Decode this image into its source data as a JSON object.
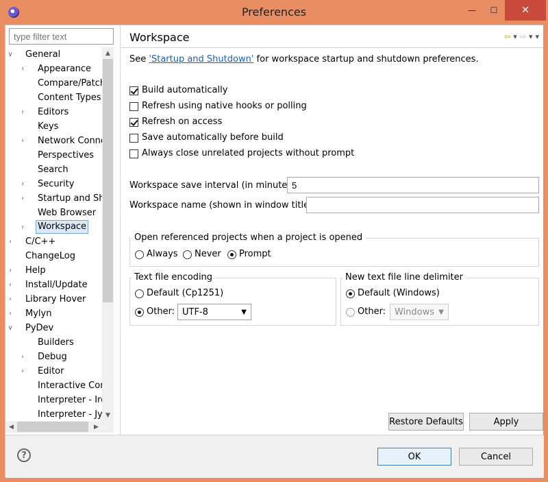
{
  "window": {
    "title": "Preferences"
  },
  "filter": {
    "placeholder": "type filter text"
  },
  "tree": {
    "items": [
      {
        "label": "General",
        "level": 0,
        "state": "expanded"
      },
      {
        "label": "Appearance",
        "level": 1,
        "state": "collapsed"
      },
      {
        "label": "Compare/Patch",
        "level": 1,
        "state": "leaf"
      },
      {
        "label": "Content Types",
        "level": 1,
        "state": "leaf"
      },
      {
        "label": "Editors",
        "level": 1,
        "state": "collapsed"
      },
      {
        "label": "Keys",
        "level": 1,
        "state": "leaf"
      },
      {
        "label": "Network Conne",
        "level": 1,
        "state": "collapsed"
      },
      {
        "label": "Perspectives",
        "level": 1,
        "state": "leaf"
      },
      {
        "label": "Search",
        "level": 1,
        "state": "leaf"
      },
      {
        "label": "Security",
        "level": 1,
        "state": "collapsed"
      },
      {
        "label": "Startup and Shu",
        "level": 1,
        "state": "collapsed"
      },
      {
        "label": "Web Browser",
        "level": 1,
        "state": "leaf"
      },
      {
        "label": "Workspace",
        "level": 1,
        "state": "collapsed",
        "selected": true
      },
      {
        "label": "C/C++",
        "level": 0,
        "state": "collapsed"
      },
      {
        "label": "ChangeLog",
        "level": 0,
        "state": "leaf"
      },
      {
        "label": "Help",
        "level": 0,
        "state": "collapsed"
      },
      {
        "label": "Install/Update",
        "level": 0,
        "state": "collapsed"
      },
      {
        "label": "Library Hover",
        "level": 0,
        "state": "collapsed"
      },
      {
        "label": "Mylyn",
        "level": 0,
        "state": "collapsed"
      },
      {
        "label": "PyDev",
        "level": 0,
        "state": "expanded"
      },
      {
        "label": "Builders",
        "level": 1,
        "state": "leaf"
      },
      {
        "label": "Debug",
        "level": 1,
        "state": "collapsed"
      },
      {
        "label": "Editor",
        "level": 1,
        "state": "collapsed"
      },
      {
        "label": "Interactive Cons",
        "level": 1,
        "state": "leaf"
      },
      {
        "label": "Interpreter - Iro",
        "level": 1,
        "state": "leaf"
      },
      {
        "label": "Interpreter - Jyt",
        "level": 1,
        "state": "leaf"
      }
    ]
  },
  "page": {
    "title": "Workspace",
    "desc_prefix": "See ",
    "desc_link": "'Startup and Shutdown'",
    "desc_suffix": " for workspace startup and shutdown preferences.",
    "checkboxes": [
      {
        "label": "Build automatically",
        "checked": true
      },
      {
        "label": "Refresh using native hooks or polling",
        "checked": false
      },
      {
        "label": "Refresh on access",
        "checked": true
      },
      {
        "label": "Save automatically before build",
        "checked": false
      },
      {
        "label": "Always close unrelated projects without prompt",
        "checked": false
      }
    ],
    "save_interval_label": "Workspace save interval (in minutes):",
    "save_interval_value": "5",
    "workspace_name_label": "Workspace name (shown in window title):",
    "workspace_name_value": "",
    "open_group": {
      "title": "Open referenced projects when a project is opened",
      "options": [
        "Always",
        "Never",
        "Prompt"
      ],
      "selected": "Prompt"
    },
    "encoding_group": {
      "title": "Text file encoding",
      "default_label": "Default (Cp1251)",
      "other_label": "Other:",
      "other_value": "UTF-8",
      "selected": "Other"
    },
    "delimiter_group": {
      "title": "New text file line delimiter",
      "default_label": "Default (Windows)",
      "other_label": "Other:",
      "other_value": "Windows",
      "selected": "Default"
    },
    "restore_defaults": "Restore Defaults",
    "apply": "Apply"
  },
  "footer": {
    "ok": "OK",
    "cancel": "Cancel",
    "help_symbol": "?"
  },
  "colors": {
    "frame": "#e98d62",
    "link": "#1a5ec3",
    "selection_bg": "#dbe9f7",
    "selection_border": "#76a6d7"
  }
}
